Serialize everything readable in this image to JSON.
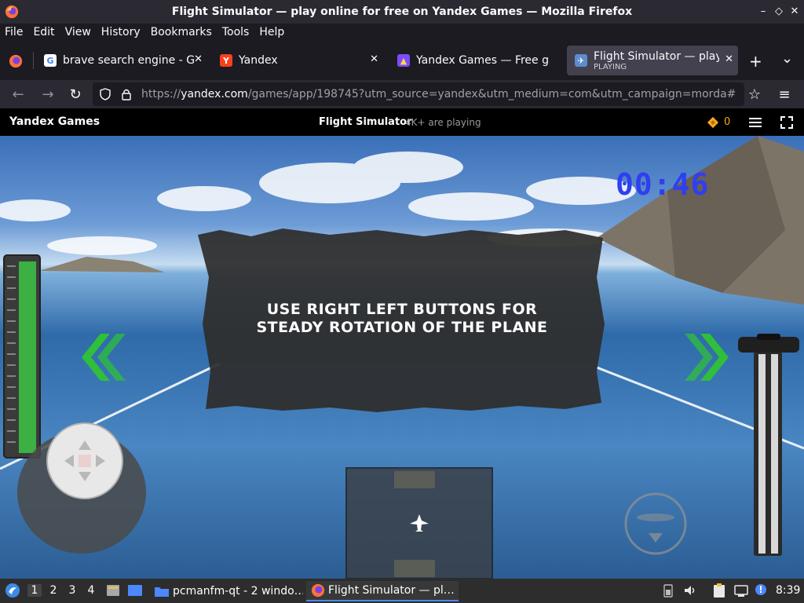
{
  "window": {
    "title": "Flight Simulator — play online for free on Yandex Games — Mozilla Firefox",
    "minimize_icon": "–",
    "maximize_icon": "◇",
    "close_icon": "✕"
  },
  "menu": [
    "File",
    "Edit",
    "View",
    "History",
    "Bookmarks",
    "Tools",
    "Help"
  ],
  "tabs": [
    {
      "label": "brave search engine - Go",
      "favicon": "G",
      "favicon_color": "#ffffff"
    },
    {
      "label": "Yandex",
      "favicon": "Y",
      "favicon_color": "#fc3f1d"
    },
    {
      "label": "Yandex Games — Free ga",
      "favicon": "🎮",
      "favicon_color": "#7b4dff"
    },
    {
      "label": "Flight Simulator — play o",
      "sub": "PLAYING",
      "favicon": "✈",
      "favicon_color": "#5d8ccc",
      "active": true
    }
  ],
  "new_tab": "+",
  "tab_list": "⌄",
  "nav": {
    "back": "←",
    "forward": "→",
    "reload": "↻",
    "url_prefix": "https://",
    "url_host": "yandex.com",
    "url_rest": "/games/app/198745?utm_source=yandex&utm_medium=com&utm_campaign=morda#",
    "bookmark": "☆",
    "menu": "≡"
  },
  "yandex_games": {
    "brand": "Yandex Games",
    "game_name": "Flight Simulator",
    "players": "4K+ are playing",
    "coins": "0"
  },
  "game": {
    "timer": "00:46",
    "hint": "USE RIGHT LEFT BUTTONS FOR STEADY ROTATION OF THE PLANE",
    "left_arrows": "«",
    "right_arrows": "»",
    "fuel_level": 1.0,
    "throttle_level": 1.0
  },
  "taskbar": {
    "workspaces": [
      "1",
      "2",
      "3",
      "4"
    ],
    "active_workspace": "1",
    "tasks": [
      {
        "label": "pcmanfm-qt - 2 windo…"
      },
      {
        "label": "Flight Simulator — pl…",
        "active": true
      }
    ],
    "clock": "8:39"
  },
  "colors": {
    "accent": "#4d88ff",
    "timer": "#2f3ff0",
    "arrows": "#2fbf3a",
    "fuel": "#3cb043"
  }
}
